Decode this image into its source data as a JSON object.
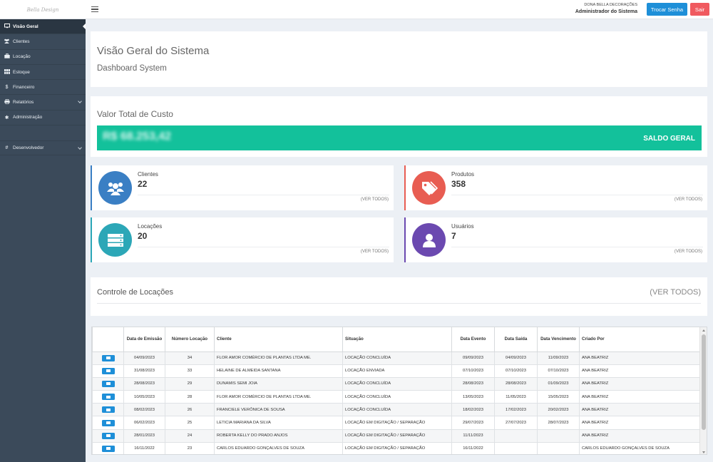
{
  "header": {
    "logo_text": "Bella Design",
    "company": "DONA BELLA DECORAÇÕES",
    "user_role": "Administrador do Sistema",
    "change_password_label": "Trocar Senha",
    "exit_label": "Sair"
  },
  "sidebar": {
    "items": [
      {
        "label": "Visão Geral",
        "icon": "monitor-icon"
      },
      {
        "label": "Clientes",
        "icon": "users-icon"
      },
      {
        "label": "Locação",
        "icon": "briefcase-icon"
      },
      {
        "label": "Estoque",
        "icon": "grid-icon"
      },
      {
        "label": "Financeiro",
        "icon": "dollar-icon"
      },
      {
        "label": "Relatórios",
        "icon": "printer-icon"
      },
      {
        "label": "Administração",
        "icon": "gear-icon"
      }
    ],
    "dev_label": "Desenvolvedor"
  },
  "overview": {
    "title": "Visão Geral do Sistema",
    "subtitle": "Dashboard System"
  },
  "cost": {
    "label": "Valor Total de Custo",
    "value": "R$ 68.253,42",
    "saldo_label": "SALDO GERAL"
  },
  "cards": {
    "clientes": {
      "title": "Clientes",
      "count": "22",
      "link": "(VER TODOS)",
      "color": "#3a7fc4"
    },
    "produtos": {
      "title": "Produtos",
      "count": "358",
      "link": "(VER TODOS)",
      "color": "#e85d52"
    },
    "locacoes": {
      "title": "Locações",
      "count": "20",
      "link": "(VER TODOS)",
      "color": "#2ca7b7"
    },
    "usuarios": {
      "title": "Usuários",
      "count": "7",
      "link": "(VER TODOS)",
      "color": "#6b49b0"
    }
  },
  "control": {
    "title": "Controle de Locações",
    "link": "(VER TODOS)"
  },
  "table": {
    "headers": {
      "emissao": "Data de Emissão",
      "numero": "Número Locação",
      "cliente": "Cliente",
      "situacao": "Situação",
      "evento": "Data Evento",
      "saida": "Data Saída",
      "vencimento": "Data Vencimento",
      "criado": "Criado Por"
    },
    "rows": [
      {
        "emissao": "04/09/2023",
        "numero": "34",
        "cliente": "FLOR AMOR COMÉRCIO DE PLANTAS LTDA ME.",
        "situacao": "LOCAÇÃO CONCLUÍDA",
        "evento": "09/09/2023",
        "saida": "04/09/2023",
        "vencimento": "11/09/2023",
        "criado": "ANA BEATRIZ"
      },
      {
        "emissao": "31/08/2023",
        "numero": "33",
        "cliente": "HELAINE DE ALMEIDA SANTANA",
        "situacao": "LOCAÇÃO ENVIADA",
        "evento": "07/10/2023",
        "saida": "07/10/2023",
        "vencimento": "07/10/2023",
        "criado": "ANA BEATRIZ"
      },
      {
        "emissao": "28/08/2023",
        "numero": "29",
        "cliente": "DUNAMIS SEMI JOIA",
        "situacao": "LOCAÇÃO CONCLUÍDA",
        "evento": "28/08/2023",
        "saida": "28/08/2023",
        "vencimento": "01/09/2023",
        "criado": "ANA BEATRIZ"
      },
      {
        "emissao": "10/05/2023",
        "numero": "28",
        "cliente": "FLOR AMOR COMÉRCIO DE PLANTAS LTDA ME.",
        "situacao": "LOCAÇÃO CONCLUÍDA",
        "evento": "13/05/2023",
        "saida": "11/05/2023",
        "vencimento": "15/05/2023",
        "criado": "ANA BEATRIZ"
      },
      {
        "emissao": "08/02/2023",
        "numero": "26",
        "cliente": "FRANCIELE VERÔNICA DE SOUSA",
        "situacao": "LOCAÇÃO CONCLUÍDA",
        "evento": "18/02/2023",
        "saida": "17/02/2023",
        "vencimento": "20/02/2023",
        "criado": "ANA BEATRIZ"
      },
      {
        "emissao": "06/02/2023",
        "numero": "25",
        "cliente": "LETICIA MARIANA DA SILVA",
        "situacao": "LOCAÇÃO EM DIGITAÇÃO / SEPARAÇÃO",
        "evento": "29/07/2023",
        "saida": "27/07/2023",
        "vencimento": "28/07/2023",
        "criado": "ANA BEATRIZ"
      },
      {
        "emissao": "28/01/2023",
        "numero": "24",
        "cliente": "ROBERTA KELLY DO PRADO ANJOS",
        "situacao": "LOCAÇÃO EM DIGITAÇÃO / SEPARAÇÃO",
        "evento": "11/11/2023",
        "saida": "",
        "vencimento": "",
        "criado": "ANA BEATRIZ"
      },
      {
        "emissao": "16/11/2022",
        "numero": "23",
        "cliente": "CARLOS EDUARDO GONÇALVES DE SOUZA",
        "situacao": "LOCAÇÃO EM DIGITAÇÃO / SEPARAÇÃO",
        "evento": "16/11/2022",
        "saida": "",
        "vencimento": "",
        "criado": "CARLOS EDUARDO GONÇALVES DE SOUZA"
      }
    ]
  }
}
